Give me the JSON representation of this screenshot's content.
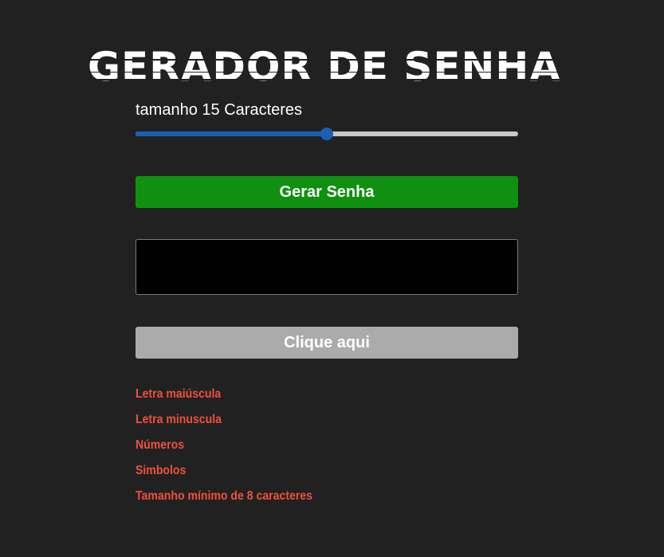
{
  "app": {
    "title": "GERADOR DE SENHA"
  },
  "length": {
    "prefix": "tamanho",
    "value": "15",
    "suffix": "Caracteres",
    "slider_fraction": 0.5
  },
  "generate_button": {
    "label": "Gerar Senha",
    "color": "#0f9010"
  },
  "password_output": {
    "value": ""
  },
  "copy_button": {
    "label": "Clique aqui",
    "color": "#ababab"
  },
  "rules": [
    {
      "label": "Letra maiúscula"
    },
    {
      "label": "Letra minuscula"
    },
    {
      "label": "Números"
    },
    {
      "label": "Simbolos"
    },
    {
      "label": "Tamanho mínimo de 8 caracteres"
    }
  ],
  "colors": {
    "background": "#212121",
    "accent": "#1a5fb4",
    "rule_text": "#f0503c"
  }
}
